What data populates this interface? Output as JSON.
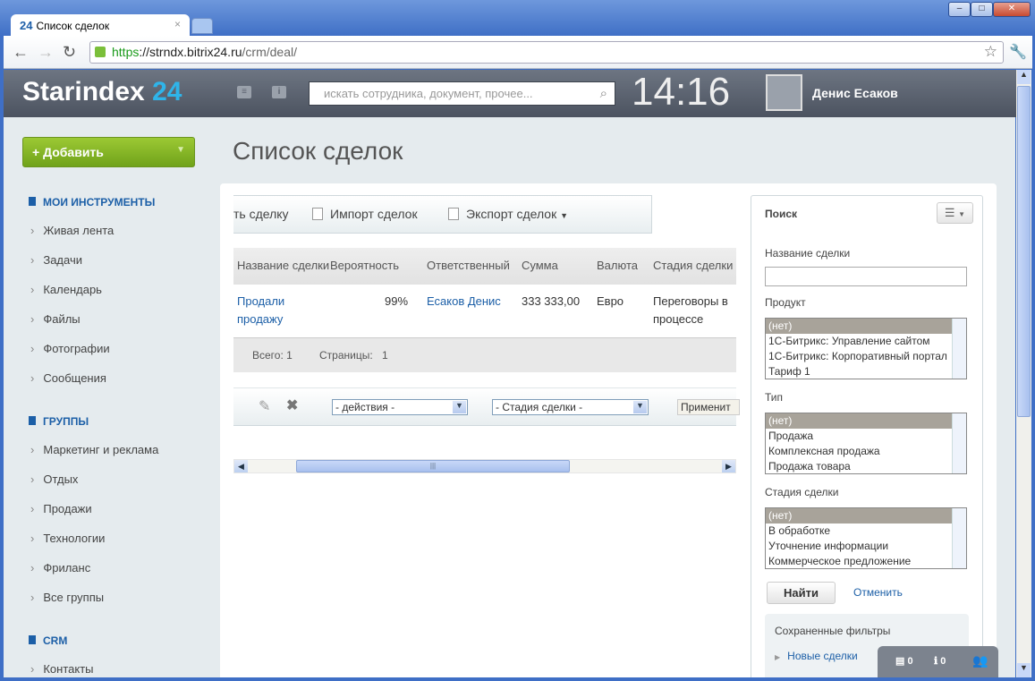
{
  "browser": {
    "tab_title": "Список сделок",
    "tab_favicon": "24",
    "url_scheme": "https",
    "url_host": "://strndx.bitrix24.ru",
    "url_path": "/crm/deal/"
  },
  "header": {
    "logo_main": "Starindex",
    "logo_num": "24",
    "search_placeholder": "искать сотрудника, документ, прочее...",
    "clock": "14:16",
    "user": "Денис Есаков"
  },
  "sidebar": {
    "add_label": "Добавить",
    "sections": [
      {
        "title": "МОИ ИНСТРУМЕНТЫ",
        "items": [
          "Живая лента",
          "Задачи",
          "Календарь",
          "Файлы",
          "Фотографии",
          "Сообщения"
        ]
      },
      {
        "title": "ГРУППЫ",
        "items": [
          "Маркетинг и реклама",
          "Отдых",
          "Продажи",
          "Технологии",
          "Фриланс",
          "Все группы"
        ]
      },
      {
        "title": "CRM",
        "items": [
          "Контакты"
        ]
      }
    ]
  },
  "page": {
    "title": "Список сделок"
  },
  "toolbar": {
    "add": "ть сделку",
    "import": "Импорт сделок",
    "export": "Экспорт сделок"
  },
  "grid": {
    "columns": [
      "Название сделки",
      "Вероятность",
      "Ответственный",
      "Сумма",
      "Валюта",
      "Стадия сделки"
    ],
    "rows": [
      {
        "name": "Продали продажу",
        "probability": "99%",
        "responsible": "Есаков Денис",
        "sum": "333 333,00",
        "currency": "Евро",
        "stage": "Переговоры в процессе"
      }
    ],
    "total": "Всего: 1",
    "pages_label": "Страницы:",
    "pages": "1"
  },
  "actions": {
    "action_select": "- действия -",
    "stage_select": "- Стадия сделки -",
    "apply": "Применит"
  },
  "filter": {
    "title": "Поиск",
    "name_label": "Название сделки",
    "name_value": "",
    "product_label": "Продукт",
    "product_options": [
      "(нет)",
      "1С-Битрикс: Управление сайтом",
      "1С-Битрикс: Корпоративный портал",
      "Тариф 1"
    ],
    "type_label": "Тип",
    "type_options": [
      "(нет)",
      "Продажа",
      "Комплексная продажа",
      "Продажа товара"
    ],
    "stage_label": "Стадия сделки",
    "stage_options": [
      "(нет)",
      "В обработке",
      "Уточнение информации",
      "Коммерческое предложение"
    ],
    "find": "Найти",
    "cancel": "Отменить",
    "saved_title": "Сохраненные фильтры",
    "saved_items": [
      "Новые сделки"
    ]
  },
  "dock": {
    "messages": "0",
    "notifications": "0"
  }
}
